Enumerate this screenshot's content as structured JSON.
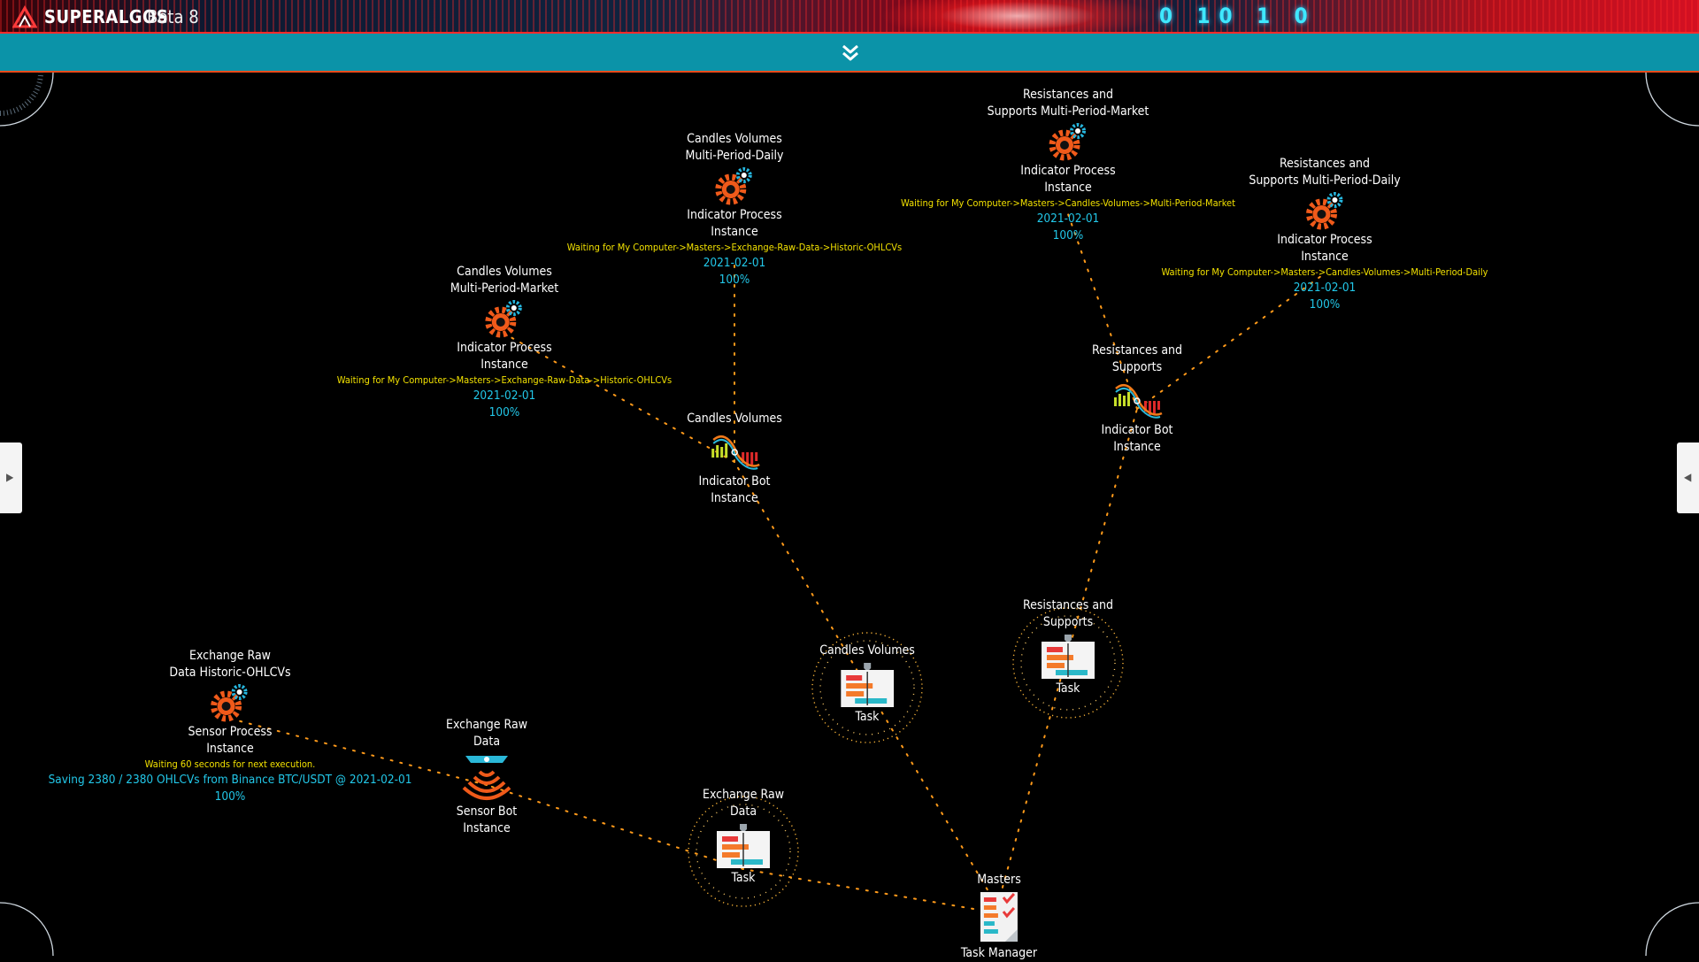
{
  "app": {
    "brand": "SUPERALGOS",
    "version": "Beta 8",
    "banner_digits": "0  10  1  0"
  },
  "dock": {
    "toggle_icon": "double-chevron-down-icon"
  },
  "side_panels": {
    "left_arrow": "▶",
    "right_arrow": "◀"
  },
  "colors": {
    "status_yellow": "#f2e100",
    "info_cyan": "#22c7e8",
    "link_orange": "#ff9a1a",
    "dock_teal": "#0b93a8",
    "top_red": "#d41022"
  },
  "nodes": {
    "rs_mpm": {
      "name": [
        "Resistances and",
        "Supports Multi-Period-Market"
      ],
      "type": [
        "Indicator Process",
        "Instance"
      ],
      "status": "Waiting for My Computer->Masters->Candles-Volumes->Multi-Period-Market",
      "date": "2021-02-01",
      "progress": "100%"
    },
    "cv_mpd": {
      "name": [
        "Candles Volumes",
        "Multi-Period-Daily"
      ],
      "type": [
        "Indicator Process",
        "Instance"
      ],
      "status": "Waiting for My Computer->Masters->Exchange-Raw-Data->Historic-OHLCVs",
      "date": "2021-02-01",
      "progress": "100%"
    },
    "rs_mpd": {
      "name": [
        "Resistances and",
        "Supports Multi-Period-Daily"
      ],
      "type": [
        "Indicator Process",
        "Instance"
      ],
      "status": "Waiting for My Computer->Masters->Candles-Volumes->Multi-Period-Daily",
      "date": "2021-02-01",
      "progress": "100%"
    },
    "cv_mpm": {
      "name": [
        "Candles Volumes",
        "Multi-Period-Market"
      ],
      "type": [
        "Indicator Process",
        "Instance"
      ],
      "status": "Waiting for My Computer->Masters->Exchange-Raw-Data->Historic-OHLCVs",
      "date": "2021-02-01",
      "progress": "100%"
    },
    "rs_bot": {
      "name": [
        "Resistances and",
        "Supports"
      ],
      "type": [
        "Indicator Bot",
        "Instance"
      ]
    },
    "cv_bot": {
      "name": [
        "Candles Volumes"
      ],
      "type": [
        "Indicator Bot",
        "Instance"
      ]
    },
    "cv_task": {
      "name": [
        "Candles Volumes"
      ],
      "type": "Task"
    },
    "rs_task": {
      "name": [
        "Resistances and",
        "Supports"
      ],
      "type": "Task"
    },
    "erd_hist": {
      "name": [
        "Exchange Raw",
        "Data Historic-OHLCVs"
      ],
      "type": [
        "Sensor Process",
        "Instance"
      ],
      "status": "Waiting 60 seconds for next execution.",
      "info": "Saving 2380 / 2380 OHLCVs from Binance BTC/USDT @ 2021-02-01",
      "progress": "100%"
    },
    "erd_sensor": {
      "name": [
        "Exchange Raw",
        "Data"
      ],
      "type": [
        "Sensor Bot",
        "Instance"
      ]
    },
    "erd_task": {
      "name": [
        "Exchange Raw",
        "Data"
      ],
      "type": "Task"
    },
    "masters": {
      "name": "Masters",
      "type": "Task Manager"
    }
  }
}
